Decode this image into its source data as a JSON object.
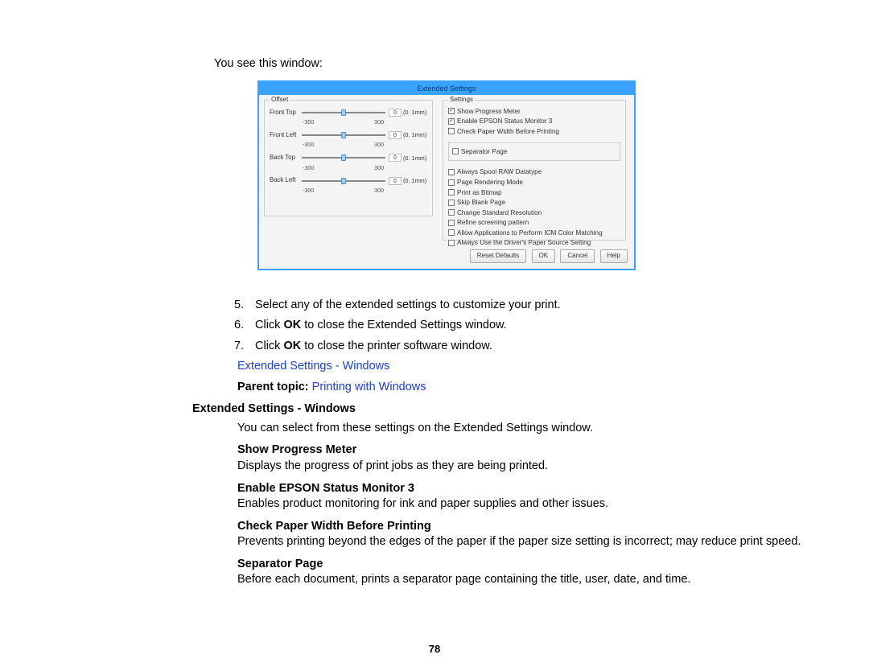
{
  "intro_text": "You see this window:",
  "dialog": {
    "title": "Extended Settings",
    "offset_group": {
      "label": "Offset",
      "rows": [
        {
          "label": "Front Top",
          "value": "0",
          "unit": "(0. 1mm)"
        },
        {
          "label": "Front Left",
          "value": "0",
          "unit": "(0. 1mm)"
        },
        {
          "label": "Back Top",
          "value": "0",
          "unit": "(0. 1mm)"
        },
        {
          "label": "Back Left",
          "value": "0",
          "unit": "(0. 1mm)"
        }
      ],
      "tick_min": "-300",
      "tick_max": "300"
    },
    "settings_group": {
      "label": "Settings",
      "top_checks": [
        {
          "label": "Show Progress Meter",
          "checked": true
        },
        {
          "label": "Enable EPSON Status Monitor 3",
          "checked": true
        },
        {
          "label": "Check Paper Width Before Printing",
          "checked": false
        }
      ],
      "separator": {
        "label": "Separator Page",
        "checked": false
      },
      "bottom_checks": [
        {
          "label": "Always Spool RAW Datatype",
          "checked": false
        },
        {
          "label": "Page Rendering Mode",
          "checked": false
        },
        {
          "label": "Print as Bitmap",
          "checked": false
        },
        {
          "label": "Skip Blank Page",
          "checked": false
        },
        {
          "label": "Change Standard Resolution",
          "checked": false
        },
        {
          "label": "Refine screening pattern",
          "checked": false
        },
        {
          "label": "Allow Applications to Perform ICM Color Matching",
          "checked": false
        },
        {
          "label": "Always Use the Driver's Paper Source Setting",
          "checked": false
        }
      ]
    },
    "buttons": {
      "reset": "Reset Defaults",
      "ok": "OK",
      "cancel": "Cancel",
      "help": "Help"
    }
  },
  "steps": {
    "s5": {
      "num": "5.",
      "text": "Select any of the extended settings to customize your print."
    },
    "s6": {
      "num": "6.",
      "prefix": "Click ",
      "bold": "OK",
      "suffix": " to close the Extended Settings window."
    },
    "s7": {
      "num": "7.",
      "prefix": "Click ",
      "bold": "OK",
      "suffix": " to close the printer software window."
    }
  },
  "link_extended": "Extended Settings - Windows",
  "parent_topic_label": "Parent topic: ",
  "parent_topic_link": "Printing with Windows",
  "section_heading": "Extended Settings - Windows",
  "section_intro": "You can select from these settings on the Extended Settings window.",
  "terms": {
    "t1": {
      "term": "Show Progress Meter",
      "def": "Displays the progress of print jobs as they are being printed."
    },
    "t2": {
      "term": "Enable EPSON Status Monitor 3",
      "def": "Enables product monitoring for ink and paper supplies and other issues."
    },
    "t3": {
      "term": "Check Paper Width Before Printing",
      "def": "Prevents printing beyond the edges of the paper if the paper size setting is incorrect; may reduce print speed."
    },
    "t4": {
      "term": "Separator Page",
      "def": "Before each document, prints a separator page containing the title, user, date, and time."
    }
  },
  "page_number": "78"
}
